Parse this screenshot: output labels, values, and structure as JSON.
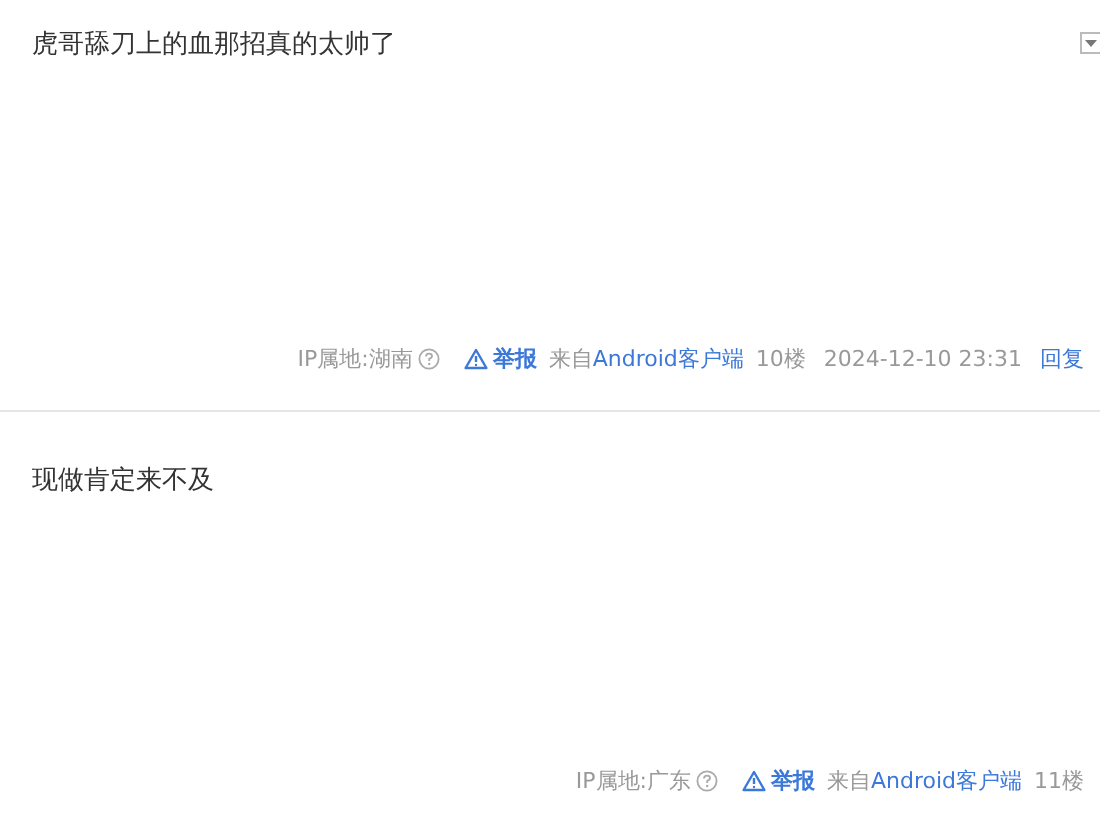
{
  "posts": [
    {
      "content": "虎哥舔刀上的血那招真的太帅了",
      "ip": "IP属地:湖南",
      "report": "举报",
      "source_prefix": "来自",
      "source": "Android客户端",
      "floor": "10楼",
      "time": "2024-12-10 23:31",
      "reply": "回复",
      "menu": true
    },
    {
      "content": "现做肯定来不及",
      "ip": "IP属地:广东",
      "report": "举报",
      "source_prefix": "来自",
      "source": "Android客户端",
      "floor": "11楼"
    }
  ]
}
